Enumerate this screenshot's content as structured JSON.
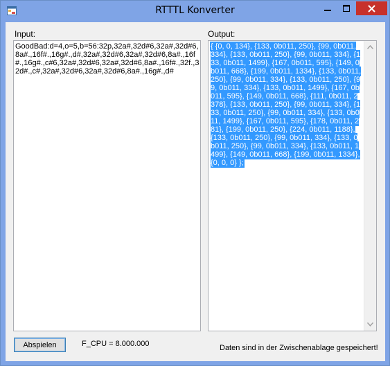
{
  "window": {
    "title": "RTTTL Konverter"
  },
  "input": {
    "label": "Input:",
    "value": "GoodBad:d=4,o=5,b=56:32p,32a#,32d#6,32a#,32d#6,8a#.,16f#.,16g#.,d#,32a#,32d#6,32a#,32d#6,8a#.,16f#.,16g#.,c#6,32a#,32d#6,32a#,32d#6,8a#.,16f#.,32f.,32d#.,c#,32a#,32d#6,32a#,32d#6,8a#.,16g#.,d#"
  },
  "output": {
    "label": "Output:",
    "value": "{ {0, 0, 134}, {133, 0b011, 250}, {99, 0b011, 334}, {133, 0b011, 250}, {99, 0b011, 334}, {133, 0b011, 1499}, {167, 0b011, 595}, {149, 0b011, 668}, {199, 0b011, 1334}, {133, 0b011, 250}, {99, 0b011, 334}, {133, 0b011, 250}, {99, 0b011, 334}, {133, 0b011, 1499}, {167, 0b011, 595}, {149, 0b011, 668}, {111, 0b011, 2378}, {133, 0b011, 250}, {99, 0b011, 334}, {133, 0b011, 250}, {99, 0b011, 334}, {133, 0b011, 1499}, {167, 0b011, 595}, {178, 0b011, 281}, {199, 0b011, 250}, {224, 0b011, 1188}, {133, 0b011, 250}, {99, 0b011, 334}, {133, 0b011, 250}, {99, 0b011, 334}, {133, 0b011, 1499}, {149, 0b011, 668}, {199, 0b011, 1334}, {0, 0, 0} };",
    "selection_color": "#3399ff"
  },
  "controls": {
    "play_label": "Abspielen",
    "fcpu": "F_CPU = 8.000.000",
    "status": "Daten sind in der Zwischenablage gespeichert!"
  },
  "colors": {
    "frame": "#7fa4e6",
    "close": "#c7312b",
    "background": "#f0f0f0"
  },
  "icons": {
    "app": "app-window-icon",
    "minimize": "minimize-icon",
    "maximize": "maximize-icon",
    "close": "close-icon"
  }
}
